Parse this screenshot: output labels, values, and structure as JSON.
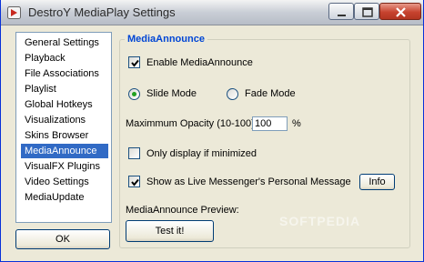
{
  "window": {
    "title": "DestroY MediaPlay Settings"
  },
  "nav": {
    "items": [
      {
        "label": "General Settings",
        "selected": false
      },
      {
        "label": "Playback",
        "selected": false
      },
      {
        "label": "File Associations",
        "selected": false
      },
      {
        "label": "Playlist",
        "selected": false
      },
      {
        "label": "Global Hotkeys",
        "selected": false
      },
      {
        "label": "Visualizations",
        "selected": false
      },
      {
        "label": "Skins Browser",
        "selected": false
      },
      {
        "label": "MediaAnnounce",
        "selected": true
      },
      {
        "label": "VisualFX Plugins",
        "selected": false
      },
      {
        "label": "Video Settings",
        "selected": false
      },
      {
        "label": "MediaUpdate",
        "selected": false
      }
    ],
    "ok_label": "OK"
  },
  "panel": {
    "title": "MediaAnnounce",
    "enable": {
      "label": "Enable MediaAnnounce",
      "checked": true
    },
    "slide_mode": {
      "label": "Slide Mode",
      "selected": true
    },
    "fade_mode": {
      "label": "Fade Mode",
      "selected": false
    },
    "opacity": {
      "label": "Maximmum Opacity (10-100)",
      "value": "100",
      "unit": "%"
    },
    "only_minimized": {
      "label": "Only display if minimized",
      "checked": false
    },
    "messenger": {
      "label": "Show as Live Messenger's Personal Message",
      "checked": true
    },
    "info_label": "Info",
    "preview_label": "MediaAnnounce Preview:",
    "test_label": "Test it!"
  },
  "watermark": "SOFTPEDIA",
  "colors": {
    "accent": "#0046d5",
    "selection": "#316ac5",
    "window_bg": "#ece9d8"
  }
}
